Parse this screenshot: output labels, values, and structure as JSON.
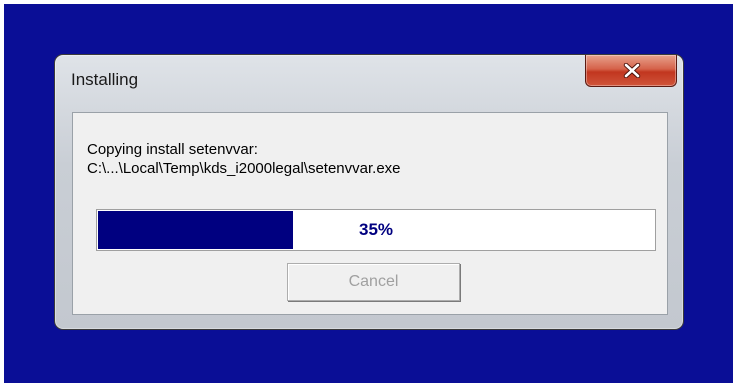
{
  "window": {
    "title": "Installing"
  },
  "message": {
    "line1": "Copying install setenvvar:",
    "line2": "C:\\...\\Local\\Temp\\kds_i2000legal\\setenvvar.exe"
  },
  "progress": {
    "percent": 35,
    "label": "35%"
  },
  "buttons": {
    "cancel_label": "Cancel",
    "cancel_enabled": false
  },
  "icons": {
    "close": "close-icon"
  },
  "colors": {
    "desktop": "#0a0e96",
    "progress_fill": "#000080",
    "progress_text": "#000080",
    "close_button": "#c1361f"
  }
}
